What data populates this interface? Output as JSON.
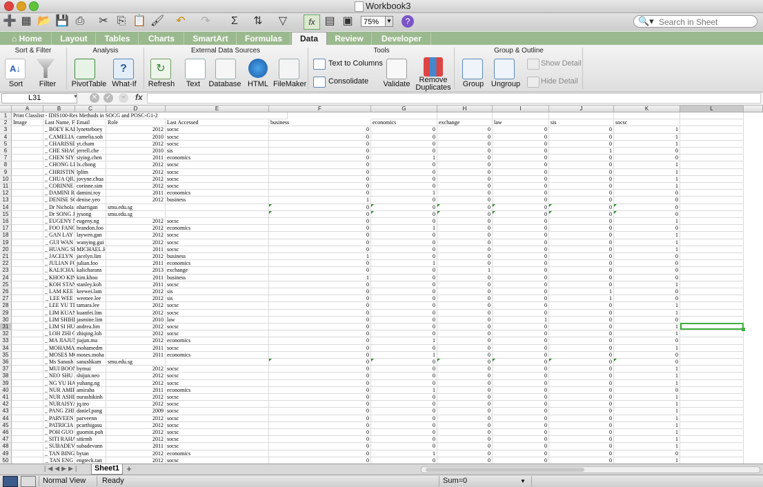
{
  "window": {
    "title": "Workbook3"
  },
  "toolbar": {
    "zoom": "75%",
    "search_placeholder": "Search in Sheet"
  },
  "tabs": [
    {
      "label": "Home"
    },
    {
      "label": "Layout"
    },
    {
      "label": "Tables"
    },
    {
      "label": "Charts"
    },
    {
      "label": "SmartArt"
    },
    {
      "label": "Formulas"
    },
    {
      "label": "Data"
    },
    {
      "label": "Review"
    },
    {
      "label": "Developer"
    }
  ],
  "ribbon": {
    "groups": {
      "sort_filter": "Sort & Filter",
      "analysis": "Analysis",
      "external": "External Data Sources",
      "tools": "Tools",
      "group_outline": "Group & Outline"
    },
    "buttons": {
      "sort": "Sort",
      "filter": "Filter",
      "pivottable": "PivotTable",
      "whatif": "What-If",
      "refresh": "Refresh",
      "text": "Text",
      "database": "Database",
      "html": "HTML",
      "filemaker": "FileMaker",
      "text_to_columns": "Text to Columns",
      "consolidate": "Consolidate",
      "validate": "Validate",
      "remove_duplicates_1": "Remove",
      "remove_duplicates_2": "Duplicates",
      "group": "Group",
      "ungroup": "Ungroup",
      "show_detail": "Show Detail",
      "hide_detail": "Hide Detail"
    }
  },
  "formula_bar": {
    "cell_ref": "L31",
    "fx": "fx",
    "value": ""
  },
  "columns": [
    "A",
    "B",
    "C",
    "D",
    "E",
    "F",
    "G",
    "H",
    "I",
    "J",
    "K",
    "L"
  ],
  "sheet": {
    "title_row": "Print Classlist - IDIS100-Res Methods in SOCG and POSC-G1-2",
    "headers": [
      "Image",
      "Last Name, F",
      "Email",
      "Role",
      "Last Accessed",
      "business",
      "economics",
      "exchange",
      "law",
      "sis",
      "socsc"
    ],
    "rows": [
      [
        "BOEY KAI",
        "lynetteboey",
        "",
        "2012",
        "socsc",
        "0",
        "0",
        "0",
        "0",
        "0",
        "1"
      ],
      [
        "CAMELIA",
        "camelia.soh",
        "",
        "2010",
        "socsc",
        "0",
        "0",
        "0",
        "0",
        "0",
        "1"
      ],
      [
        "CHARISSE",
        "yt.cham",
        "",
        "2012",
        "socsc",
        "0",
        "0",
        "0",
        "0",
        "0",
        "1"
      ],
      [
        "CHE SHAC",
        "jerrell.che",
        "",
        "2010",
        "sis",
        "0",
        "0",
        "0",
        "0",
        "1",
        "0"
      ],
      [
        "CHEN SIYI",
        "siying.chen",
        "",
        "2011",
        "economics",
        "0",
        "1",
        "0",
        "0",
        "0",
        "0"
      ],
      [
        "CHONG LI",
        "lx.chong",
        "",
        "2012",
        "socsc",
        "0",
        "0",
        "0",
        "0",
        "0",
        "1"
      ],
      [
        "CHRISTIN",
        "lplim",
        "",
        "2012",
        "socsc",
        "0",
        "0",
        "0",
        "0",
        "0",
        "1"
      ],
      [
        "CHUA QIU",
        "jovyne.chua",
        "",
        "2012",
        "socsc",
        "0",
        "0",
        "0",
        "0",
        "0",
        "1"
      ],
      [
        "CORINNE",
        "corinne.sim",
        "",
        "2012",
        "socsc",
        "0",
        "0",
        "0",
        "0",
        "0",
        "1"
      ],
      [
        "DAMINI R",
        "damini.roy",
        "",
        "2011",
        "economics",
        "0",
        "1",
        "0",
        "0",
        "0",
        "0"
      ],
      [
        "DENISE SC",
        "denise.yeo",
        "",
        "2012",
        "business",
        "1",
        "0",
        "0",
        "0",
        "0",
        "0"
      ],
      [
        "Dr Nichola",
        "nharrigan",
        "smu.edu.sg",
        "",
        "",
        "0",
        "0",
        "0",
        "0",
        "0",
        "0"
      ],
      [
        "Dr SONG J",
        "jysong",
        "smu.edu.sg",
        "",
        "",
        "0",
        "0",
        "0",
        "0",
        "0",
        "0"
      ],
      [
        "EUGENY N",
        "eugeny.ng",
        "",
        "2012",
        "socsc",
        "0",
        "0",
        "0",
        "0",
        "0",
        "1"
      ],
      [
        "FOO FANC",
        "brandon.foo",
        "",
        "2012",
        "economics",
        "0",
        "1",
        "0",
        "0",
        "0",
        "0"
      ],
      [
        "GAN LAY Y",
        "laywen.gan",
        "",
        "2012",
        "socsc",
        "0",
        "0",
        "0",
        "0",
        "0",
        "1"
      ],
      [
        "GUI WAN",
        "wanying.gui",
        "",
        "2012",
        "socsc",
        "0",
        "0",
        "0",
        "0",
        "0",
        "1"
      ],
      [
        "HUANG SI",
        "MICHAEL.H",
        "",
        "2011",
        "socsc",
        "0",
        "0",
        "0",
        "0",
        "0",
        "1"
      ],
      [
        "JACELYN L",
        "jacelyn.lim",
        "",
        "2012",
        "business",
        "1",
        "0",
        "0",
        "0",
        "0",
        "0"
      ],
      [
        "JULIAN FO",
        "julian.foo",
        "",
        "2011",
        "economics",
        "0",
        "1",
        "0",
        "0",
        "0",
        "0"
      ],
      [
        "KALICHAR",
        "kalicharans",
        "",
        "2013",
        "exchange",
        "0",
        "0",
        "1",
        "0",
        "0",
        "0"
      ],
      [
        "KHOO KIN",
        "kim.khoo",
        "",
        "2011",
        "business",
        "1",
        "0",
        "0",
        "0",
        "0",
        "0"
      ],
      [
        "KOH STAN",
        "stanley.koh",
        "",
        "2011",
        "socsc",
        "0",
        "0",
        "0",
        "0",
        "0",
        "1"
      ],
      [
        "LAM KEE",
        "keewei.lam",
        "",
        "2012",
        "sis",
        "0",
        "0",
        "0",
        "0",
        "1",
        "0"
      ],
      [
        "LEE WEE",
        "weenee.lee",
        "",
        "2012",
        "sis",
        "0",
        "0",
        "0",
        "0",
        "1",
        "0"
      ],
      [
        "LEE YU TI",
        "tamara.lee",
        "",
        "2012",
        "socsc",
        "0",
        "0",
        "0",
        "0",
        "0",
        "1"
      ],
      [
        "LIM KUAN",
        "kuanfei.lim",
        "",
        "2012",
        "socsc",
        "0",
        "0",
        "0",
        "0",
        "0",
        "1"
      ],
      [
        "LIM SHIHI",
        "jasmine.lim",
        "",
        "2010",
        "law",
        "0",
        "0",
        "0",
        "1",
        "0",
        "0"
      ],
      [
        "LIM SI HU",
        "andrea.lim",
        "",
        "2012",
        "socsc",
        "0",
        "0",
        "0",
        "0",
        "0",
        "1"
      ],
      [
        "LOH ZHI C",
        "zhiqing.loh",
        "",
        "2012",
        "socsc",
        "0",
        "0",
        "0",
        "0",
        "0",
        "1"
      ],
      [
        "MA JIAJUN",
        "jiajun.ma",
        "",
        "2012",
        "economics",
        "0",
        "1",
        "0",
        "0",
        "0",
        "0"
      ],
      [
        "MOHAMA",
        "mohamedm",
        "",
        "2011",
        "socsc",
        "0",
        "0",
        "0",
        "0",
        "0",
        "1"
      ],
      [
        "MOSES MC",
        "moses.moha",
        "",
        "2011",
        "economics",
        "0",
        "1",
        "0",
        "0",
        "0",
        "0"
      ],
      [
        "Ms Sanush",
        "sanushkam",
        "smu.edu.sg",
        "",
        "",
        "0",
        "0",
        "0",
        "0",
        "0",
        "0"
      ],
      [
        "MUI BOON",
        "bymui",
        "",
        "2012",
        "socsc",
        "0",
        "0",
        "0",
        "0",
        "0",
        "1"
      ],
      [
        "NEO SHU J",
        "shijun.neo",
        "",
        "2012",
        "socsc",
        "0",
        "0",
        "0",
        "0",
        "0",
        "1"
      ],
      [
        "NG YU HA",
        "yuhang.ng",
        "",
        "2012",
        "socsc",
        "0",
        "0",
        "0",
        "0",
        "0",
        "1"
      ],
      [
        "NUR AMIR",
        "amiraha",
        "",
        "2011",
        "economics",
        "0",
        "1",
        "0",
        "0",
        "0",
        "0"
      ],
      [
        "NUR ASHI",
        "nurashikinh",
        "",
        "2012",
        "socsc",
        "0",
        "0",
        "0",
        "0",
        "0",
        "1"
      ],
      [
        "NURAISYA",
        "jq.teo",
        "",
        "2012",
        "socsc",
        "0",
        "0",
        "0",
        "0",
        "0",
        "1"
      ],
      [
        "PANG ZHI",
        "daniel.pang",
        "",
        "2009",
        "socsc",
        "0",
        "0",
        "0",
        "0",
        "0",
        "1"
      ],
      [
        "PARVEEN",
        "parveenn",
        "",
        "2012",
        "socsc",
        "0",
        "0",
        "0",
        "0",
        "0",
        "1"
      ],
      [
        "PATRICIA",
        "pcarthigasu",
        "",
        "2012",
        "socsc",
        "0",
        "0",
        "0",
        "0",
        "0",
        "1"
      ],
      [
        "POH GUO",
        "guomin.poh",
        "",
        "2012",
        "socsc",
        "0",
        "0",
        "0",
        "0",
        "0",
        "1"
      ],
      [
        "SITI RAHA",
        "sitirmb",
        "",
        "2012",
        "socsc",
        "0",
        "0",
        "0",
        "0",
        "0",
        "1"
      ],
      [
        "SUBADEV",
        "subadevann",
        "",
        "2011",
        "socsc",
        "0",
        "0",
        "0",
        "0",
        "0",
        "1"
      ],
      [
        "TAN BING",
        "bytan",
        "",
        "2012",
        "economics",
        "0",
        "1",
        "0",
        "0",
        "0",
        "0"
      ],
      [
        "TAN ENG",
        "engteck.tan",
        "",
        "2012",
        "socsc",
        "0",
        "0",
        "0",
        "0",
        "0",
        "1"
      ]
    ]
  },
  "sheet_tabs": {
    "active": "Sheet1",
    "add": "+"
  },
  "status": {
    "view": "Normal View",
    "state": "Ready",
    "sum": "Sum=0"
  }
}
